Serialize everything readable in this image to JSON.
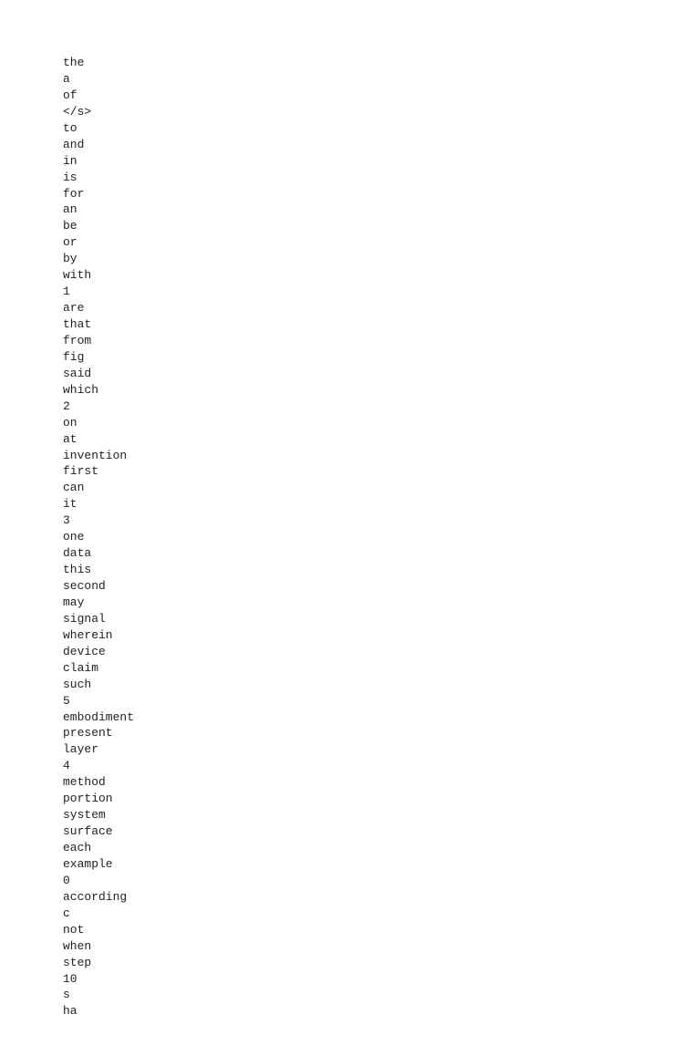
{
  "wordlist": {
    "items": [
      "the",
      "a",
      "of",
      "</s>",
      "to",
      "and",
      "in",
      "is",
      "for",
      "an",
      "be",
      "or",
      "by",
      "with",
      "1",
      "are",
      "that",
      "from",
      "fig",
      "said",
      "which",
      "2",
      "on",
      "at",
      "invention",
      "first",
      "can",
      "it",
      "3",
      "one",
      "data",
      "this",
      "second",
      "may",
      "signal",
      "wherein",
      "device",
      "claim",
      "such",
      "5",
      "embodiment",
      "present",
      "layer",
      "4",
      "method",
      "portion",
      "system",
      "surface",
      "each",
      "example",
      "0",
      "according",
      "c",
      "not",
      "when",
      "step",
      "10",
      "s",
      "ha"
    ]
  }
}
